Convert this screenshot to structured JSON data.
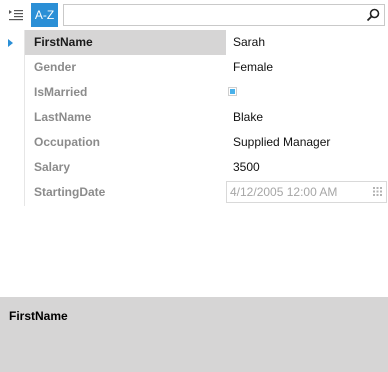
{
  "toolbar": {
    "categorize_icon": "categorized-list-icon",
    "sort_label": "A-Z",
    "search": {
      "value": "",
      "placeholder": ""
    },
    "search_icon": "magnifier-icon"
  },
  "properties": [
    {
      "name": "FirstName",
      "value": "Sarah",
      "selected": true
    },
    {
      "name": "Gender",
      "value": "Female"
    },
    {
      "name": "IsMarried",
      "checked": true
    },
    {
      "name": "LastName",
      "value": "Blake"
    },
    {
      "name": "Occupation",
      "value": "Supplied Manager"
    },
    {
      "name": "Salary",
      "value": "3500"
    },
    {
      "name": "StartingDate",
      "value": "4/12/2005 12:00 AM"
    }
  ],
  "description": {
    "title": "FirstName"
  },
  "colors": {
    "accent": "#2b8fd6",
    "selected_row": "#d6d5d5",
    "checkbox_fill": "#49b1ea"
  }
}
